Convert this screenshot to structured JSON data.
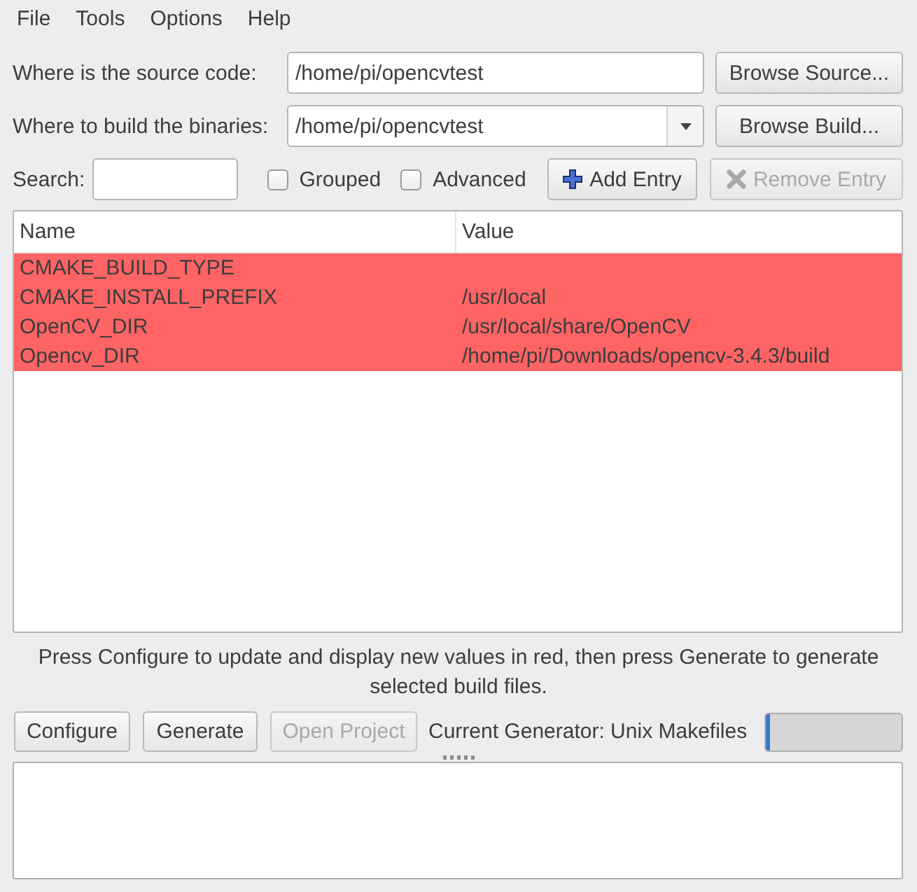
{
  "menu_bar": [
    {
      "label": "File"
    },
    {
      "label": "Tools"
    },
    {
      "label": "Options"
    },
    {
      "label": "Help"
    }
  ],
  "source": {
    "label": "Where is the source code:",
    "value": "/home/pi/opencvtest",
    "button": {
      "label": "Browse Source..."
    }
  },
  "build": {
    "label": "Where to build the binaries:",
    "value": "/home/pi/opencvtest",
    "button": {
      "label": "Browse Build..."
    }
  },
  "search": {
    "label": "Search:"
  },
  "options": [
    {
      "label": "Grouped",
      "checked": false
    },
    {
      "label": "Advanced",
      "checked": false
    }
  ],
  "entry_buttons": [
    {
      "label": "Add Entry",
      "kind": "add",
      "disabled": false
    },
    {
      "label": "Remove Entry",
      "kind": "remove",
      "disabled": true
    }
  ],
  "table": {
    "columns": [
      "Name",
      "Value"
    ],
    "rows": [
      {
        "name": "CMAKE_BUILD_TYPE",
        "new": true
      },
      {
        "name": "CMAKE_INSTALL_PREFIX",
        "value": "/usr/local",
        "new": true
      },
      {
        "name": "OpenCV_DIR",
        "value": "/usr/local/share/OpenCV",
        "new": true
      },
      {
        "name": "Opencv_DIR",
        "value": "/home/pi/Downloads/opencv-3.4.3/build",
        "new": true
      }
    ]
  },
  "message": "Press Configure to update and display new values in red, then press Generate to generate selected build files.",
  "actions": [
    {
      "label": "Configure",
      "disabled": false
    },
    {
      "label": "Generate",
      "disabled": false
    },
    {
      "label": "Open Project",
      "disabled": true
    }
  ],
  "generator": "Current Generator: Unix Makefiles",
  "progress": {
    "level": 0.03
  }
}
